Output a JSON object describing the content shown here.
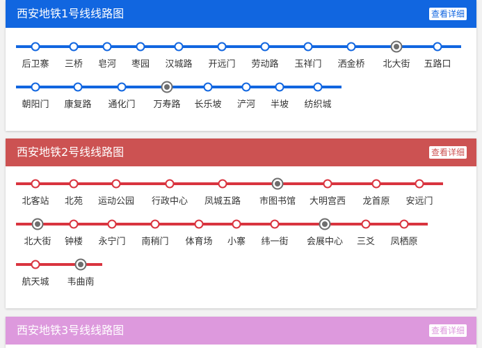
{
  "lines": [
    {
      "title": "西安地铁1号线线路图",
      "detail_label": "查看详细",
      "color": "#1166e0",
      "stations_rows": [
        [
          {
            "name": "后卫寨",
            "transfer": false
          },
          {
            "name": "三桥",
            "transfer": false
          },
          {
            "name": "皂河",
            "transfer": false
          },
          {
            "name": "枣园",
            "transfer": false
          },
          {
            "name": "汉城路",
            "transfer": false
          },
          {
            "name": "开远门",
            "transfer": false
          },
          {
            "name": "劳动路",
            "transfer": false
          },
          {
            "name": "玉祥门",
            "transfer": false
          },
          {
            "name": "洒金桥",
            "transfer": false
          },
          {
            "name": "北大街",
            "transfer": true
          },
          {
            "name": "五路口",
            "transfer": false
          }
        ],
        [
          {
            "name": "朝阳门",
            "transfer": false
          },
          {
            "name": "康复路",
            "transfer": false
          },
          {
            "name": "通化门",
            "transfer": false
          },
          {
            "name": "万寿路",
            "transfer": true
          },
          {
            "name": "长乐坡",
            "transfer": false
          },
          {
            "name": "浐河",
            "transfer": false
          },
          {
            "name": "半坡",
            "transfer": false
          },
          {
            "name": "纺织城",
            "transfer": false
          }
        ]
      ]
    },
    {
      "title": "西安地铁2号线线路图",
      "detail_label": "查看详细",
      "color": "#cc5252",
      "track_color": "#d9343f",
      "stations_rows": [
        [
          {
            "name": "北客站",
            "transfer": false
          },
          {
            "name": "北苑",
            "transfer": false
          },
          {
            "name": "运动公园",
            "transfer": false
          },
          {
            "name": "行政中心",
            "transfer": false
          },
          {
            "name": "凤城五路",
            "transfer": false
          },
          {
            "name": "市图书馆",
            "transfer": true
          },
          {
            "name": "大明宫西",
            "transfer": false
          },
          {
            "name": "龙首原",
            "transfer": false
          },
          {
            "name": "安远门",
            "transfer": false
          }
        ],
        [
          {
            "name": "北大街",
            "transfer": true
          },
          {
            "name": "钟楼",
            "transfer": false
          },
          {
            "name": "永宁门",
            "transfer": false
          },
          {
            "name": "南稍门",
            "transfer": false
          },
          {
            "name": "体育场",
            "transfer": false
          },
          {
            "name": "小寨",
            "transfer": false
          },
          {
            "name": "纬一街",
            "transfer": false
          },
          {
            "name": "会展中心",
            "transfer": true
          },
          {
            "name": "三爻",
            "transfer": false
          },
          {
            "name": "凤栖原",
            "transfer": false
          }
        ],
        [
          {
            "name": "航天城",
            "transfer": false
          },
          {
            "name": "韦曲南",
            "transfer": true
          }
        ]
      ]
    },
    {
      "title": "西安地铁3号线线路图",
      "detail_label": "查看详细",
      "color": "#dd99dd",
      "stations_rows": []
    }
  ]
}
